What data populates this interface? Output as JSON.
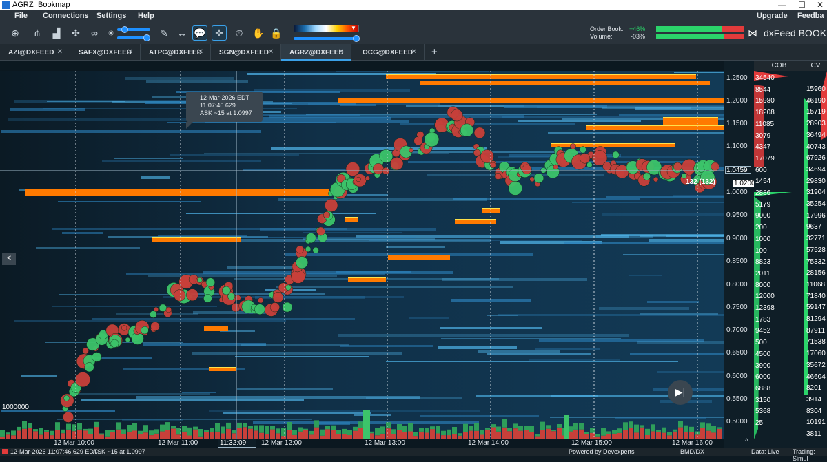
{
  "window": {
    "ticker": "AGRZ",
    "app_name": "Bookmap",
    "min": "—",
    "max": "☐",
    "close": "✕"
  },
  "menu": {
    "items": [
      "File",
      "Connections",
      "Settings",
      "Help"
    ],
    "upgrade": "Upgrade",
    "feedback": "Feedba"
  },
  "toolbar": {
    "icons": [
      "add-chart-icon",
      "network-icon",
      "bar-chart-icon",
      "layout-icon",
      "link-icon",
      "brightness-icon",
      "pencil-icon",
      "ruler-icon",
      "comment-icon",
      "crosshair-icon",
      "stopwatch-icon",
      "hand-icon",
      "lock-icon"
    ],
    "order_book_label": "Order Book:",
    "order_book_value": "+46%",
    "volume_label": "Volume:",
    "volume_value": "-03%",
    "brand": "dxFeed BOOK",
    "colors": {
      "positive": "#2bd46a",
      "negative": "#e23b3b",
      "accent": "#1e90ff"
    }
  },
  "tabs": [
    {
      "label": "AZI@DXFEED",
      "close": "✕"
    },
    {
      "label": "SAFX@DXFEED",
      "close": "✕"
    },
    {
      "label": "ATPC@DXFEED",
      "close": "✕"
    },
    {
      "label": "SGN@DXFEED",
      "close": "✕"
    },
    {
      "label": "AGRZ@DXFEED",
      "close": "✕",
      "selected": true
    },
    {
      "label": "OCG@DXFEED",
      "close": "✕"
    }
  ],
  "add_tab": "+",
  "columns": {
    "cob": "COB",
    "cvd": "CV"
  },
  "price_axis": [
    "1.2500",
    "1.2000",
    "1.1500",
    "1.1000",
    "1.0459",
    "1.0200",
    "1.0000",
    "0.9500",
    "0.9000",
    "0.8500",
    "0.8000",
    "0.7500",
    "0.7000",
    "0.6500",
    "0.6000",
    "0.5500",
    "0.5000"
  ],
  "cob_values": [
    "34540",
    "8544",
    "15980",
    "18208",
    "11085",
    "3079",
    "4347",
    "17079",
    "600",
    "1454",
    "2886",
    "5179",
    "9000",
    "200",
    "1000",
    "100",
    "8823",
    "2011",
    "8000",
    "12000",
    "12398",
    "1783",
    "9452",
    "500",
    "4500",
    "3900",
    "6000",
    "6888",
    "3150",
    "5368",
    "25"
  ],
  "cvd_values": [
    "15960",
    "46190",
    "15719",
    "28903",
    "36494",
    "40743",
    "67926",
    "34694",
    "29830",
    "31904",
    "35254",
    "17996",
    "9637",
    "32771",
    "57528",
    "75332",
    "28156",
    "11068",
    "71840",
    "59147",
    "81294",
    "87911",
    "71538",
    "17060",
    "35672",
    "46604",
    "8201",
    "3914",
    "8304",
    "10191",
    "3811"
  ],
  "crosshair_time": "11:32:09",
  "current_price": "1.0459",
  "last_trade": "132 (132)",
  "last_price": "1.0200",
  "volume_scale": "1000000",
  "time_axis": [
    "12 Mar 10:00",
    "12 Mar 11:00",
    "12 Mar 12:00",
    "12 Mar 13:00",
    "12 Mar 14:00",
    "12 Mar 15:00",
    "12 Mar 16:00"
  ],
  "tooltip": {
    "date": "12-Mar-2026 EDT",
    "time": "11:07:46.629",
    "text": "ASK ~15 at 1.0997"
  },
  "status": {
    "datetime": "12-Mar-2026 11:07:46.629 EDT",
    "quote": "ASK ~15 at 1.0997",
    "powered": "Powered by Devexperts",
    "feed": "BMD/DX",
    "data": "Data: Live",
    "trading": "Trading: Simul"
  },
  "collapse_arrow": "<",
  "play_icon": "▶|"
}
